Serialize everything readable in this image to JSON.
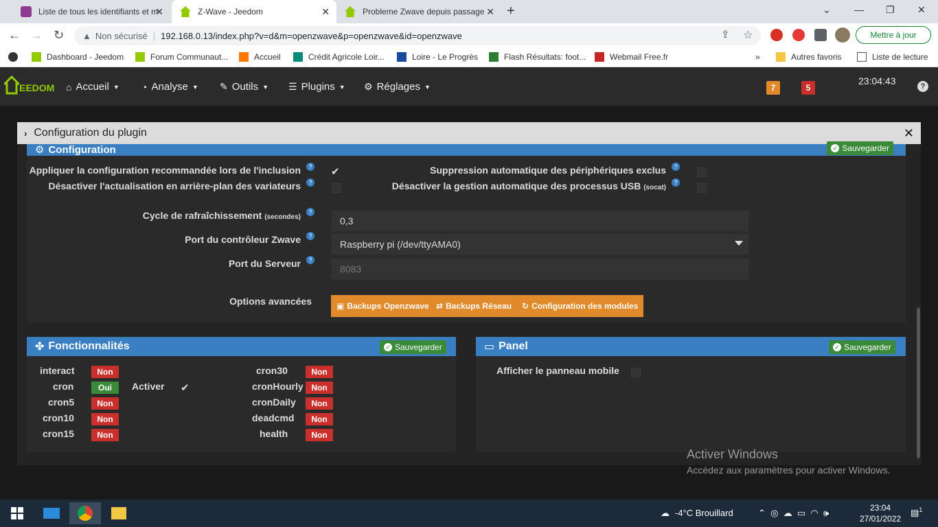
{
  "browser": {
    "tabs": [
      {
        "title": "Liste de tous les identifiants et m",
        "close": "✕"
      },
      {
        "title": "Z-Wave - Jeedom",
        "close": "✕"
      },
      {
        "title": "Probleme Zwave depuis passage",
        "close": "✕"
      }
    ],
    "new_tab": "+",
    "security_label": "Non sécurisé",
    "separator": "|",
    "url": "192.168.0.13/index.php?v=d&m=openzwave&p=openzwave&id=openzwave",
    "update_label": "Mettre à jour",
    "bookmarks": [
      "Dashboard - Jeedom",
      "Forum Communaut...",
      "Accueil",
      "Crédit Agricole Loir...",
      "Loire - Le Progrès",
      "Flash Résultats: foot...",
      "Webmail Free.fr"
    ],
    "bookmarks_more": "»",
    "other_favorites": "Autres favoris",
    "reading_list": "Liste de lecture"
  },
  "jeedom": {
    "logo": "EEDOM",
    "menu": [
      "Accueil",
      "Analyse",
      "Outils",
      "Plugins",
      "Réglages"
    ],
    "badges": [
      {
        "value": "7",
        "color": "#e08a2c"
      },
      {
        "value": "5",
        "color": "#c9302c"
      }
    ],
    "clock": "23:04:43",
    "help": "?"
  },
  "modal": {
    "title": "Configuration du plugin",
    "close": "✕"
  },
  "config": {
    "title": "Configuration",
    "save": "Sauvegarder",
    "apply_recommended": "Appliquer la configuration recommandée lors de l'inclusion",
    "disable_bg_refresh": "Désactiver l'actualisation en arrière-plan des variateurs",
    "auto_remove": "Suppression automatique des périphériques exclus",
    "disable_usb": "Désactiver la gestion automatique des processus USB",
    "disable_usb_small": "(socat)",
    "cycle_label": "Cycle de rafraîchissement",
    "cycle_small": "(secondes)",
    "cycle_value": "0,3",
    "port_label": "Port du contrôleur Zwave",
    "port_value": "Raspberry pi (/dev/ttyAMA0)",
    "server_label": "Port du Serveur",
    "server_placeholder": "8083",
    "advanced_label": "Options avancées",
    "btn_backups": "Backups Openzwave",
    "btn_network": "Backups Réseau",
    "btn_modules": "Configuration des modules"
  },
  "functions": {
    "title": "Fonctionnalités",
    "save": "Sauvegarder",
    "activate": "Activer",
    "left": [
      {
        "name": "interact",
        "state": "Non"
      },
      {
        "name": "cron",
        "state": "Oui"
      },
      {
        "name": "cron5",
        "state": "Non"
      },
      {
        "name": "cron10",
        "state": "Non"
      },
      {
        "name": "cron15",
        "state": "Non"
      }
    ],
    "right": [
      {
        "name": "cron30",
        "state": "Non"
      },
      {
        "name": "cronHourly",
        "state": "Non"
      },
      {
        "name": "cronDaily",
        "state": "Non"
      },
      {
        "name": "deadcmd",
        "state": "Non"
      },
      {
        "name": "health",
        "state": "Non"
      }
    ]
  },
  "panel": {
    "title": "Panel",
    "save": "Sauvegarder",
    "mobile_label": "Afficher le panneau mobile"
  },
  "watermark": {
    "line1": "Activer Windows",
    "line2": "Accédez aux paramètres pour activer Windows."
  },
  "taskbar": {
    "weather": "-4°C  Brouillard",
    "time": "23:04",
    "date": "27/01/2022",
    "notif": "1"
  }
}
